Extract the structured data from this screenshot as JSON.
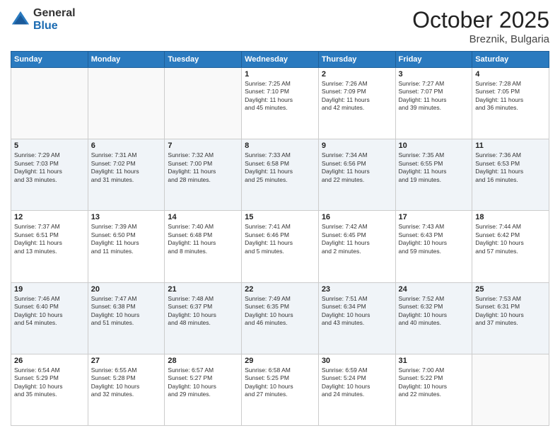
{
  "header": {
    "logo_general": "General",
    "logo_blue": "Blue",
    "month_title": "October 2025",
    "location": "Breznik, Bulgaria"
  },
  "days_of_week": [
    "Sunday",
    "Monday",
    "Tuesday",
    "Wednesday",
    "Thursday",
    "Friday",
    "Saturday"
  ],
  "weeks": [
    [
      {
        "day": "",
        "info": ""
      },
      {
        "day": "",
        "info": ""
      },
      {
        "day": "",
        "info": ""
      },
      {
        "day": "1",
        "info": "Sunrise: 7:25 AM\nSunset: 7:10 PM\nDaylight: 11 hours\nand 45 minutes."
      },
      {
        "day": "2",
        "info": "Sunrise: 7:26 AM\nSunset: 7:09 PM\nDaylight: 11 hours\nand 42 minutes."
      },
      {
        "day": "3",
        "info": "Sunrise: 7:27 AM\nSunset: 7:07 PM\nDaylight: 11 hours\nand 39 minutes."
      },
      {
        "day": "4",
        "info": "Sunrise: 7:28 AM\nSunset: 7:05 PM\nDaylight: 11 hours\nand 36 minutes."
      }
    ],
    [
      {
        "day": "5",
        "info": "Sunrise: 7:29 AM\nSunset: 7:03 PM\nDaylight: 11 hours\nand 33 minutes."
      },
      {
        "day": "6",
        "info": "Sunrise: 7:31 AM\nSunset: 7:02 PM\nDaylight: 11 hours\nand 31 minutes."
      },
      {
        "day": "7",
        "info": "Sunrise: 7:32 AM\nSunset: 7:00 PM\nDaylight: 11 hours\nand 28 minutes."
      },
      {
        "day": "8",
        "info": "Sunrise: 7:33 AM\nSunset: 6:58 PM\nDaylight: 11 hours\nand 25 minutes."
      },
      {
        "day": "9",
        "info": "Sunrise: 7:34 AM\nSunset: 6:56 PM\nDaylight: 11 hours\nand 22 minutes."
      },
      {
        "day": "10",
        "info": "Sunrise: 7:35 AM\nSunset: 6:55 PM\nDaylight: 11 hours\nand 19 minutes."
      },
      {
        "day": "11",
        "info": "Sunrise: 7:36 AM\nSunset: 6:53 PM\nDaylight: 11 hours\nand 16 minutes."
      }
    ],
    [
      {
        "day": "12",
        "info": "Sunrise: 7:37 AM\nSunset: 6:51 PM\nDaylight: 11 hours\nand 13 minutes."
      },
      {
        "day": "13",
        "info": "Sunrise: 7:39 AM\nSunset: 6:50 PM\nDaylight: 11 hours\nand 11 minutes."
      },
      {
        "day": "14",
        "info": "Sunrise: 7:40 AM\nSunset: 6:48 PM\nDaylight: 11 hours\nand 8 minutes."
      },
      {
        "day": "15",
        "info": "Sunrise: 7:41 AM\nSunset: 6:46 PM\nDaylight: 11 hours\nand 5 minutes."
      },
      {
        "day": "16",
        "info": "Sunrise: 7:42 AM\nSunset: 6:45 PM\nDaylight: 11 hours\nand 2 minutes."
      },
      {
        "day": "17",
        "info": "Sunrise: 7:43 AM\nSunset: 6:43 PM\nDaylight: 10 hours\nand 59 minutes."
      },
      {
        "day": "18",
        "info": "Sunrise: 7:44 AM\nSunset: 6:42 PM\nDaylight: 10 hours\nand 57 minutes."
      }
    ],
    [
      {
        "day": "19",
        "info": "Sunrise: 7:46 AM\nSunset: 6:40 PM\nDaylight: 10 hours\nand 54 minutes."
      },
      {
        "day": "20",
        "info": "Sunrise: 7:47 AM\nSunset: 6:38 PM\nDaylight: 10 hours\nand 51 minutes."
      },
      {
        "day": "21",
        "info": "Sunrise: 7:48 AM\nSunset: 6:37 PM\nDaylight: 10 hours\nand 48 minutes."
      },
      {
        "day": "22",
        "info": "Sunrise: 7:49 AM\nSunset: 6:35 PM\nDaylight: 10 hours\nand 46 minutes."
      },
      {
        "day": "23",
        "info": "Sunrise: 7:51 AM\nSunset: 6:34 PM\nDaylight: 10 hours\nand 43 minutes."
      },
      {
        "day": "24",
        "info": "Sunrise: 7:52 AM\nSunset: 6:32 PM\nDaylight: 10 hours\nand 40 minutes."
      },
      {
        "day": "25",
        "info": "Sunrise: 7:53 AM\nSunset: 6:31 PM\nDaylight: 10 hours\nand 37 minutes."
      }
    ],
    [
      {
        "day": "26",
        "info": "Sunrise: 6:54 AM\nSunset: 5:29 PM\nDaylight: 10 hours\nand 35 minutes."
      },
      {
        "day": "27",
        "info": "Sunrise: 6:55 AM\nSunset: 5:28 PM\nDaylight: 10 hours\nand 32 minutes."
      },
      {
        "day": "28",
        "info": "Sunrise: 6:57 AM\nSunset: 5:27 PM\nDaylight: 10 hours\nand 29 minutes."
      },
      {
        "day": "29",
        "info": "Sunrise: 6:58 AM\nSunset: 5:25 PM\nDaylight: 10 hours\nand 27 minutes."
      },
      {
        "day": "30",
        "info": "Sunrise: 6:59 AM\nSunset: 5:24 PM\nDaylight: 10 hours\nand 24 minutes."
      },
      {
        "day": "31",
        "info": "Sunrise: 7:00 AM\nSunset: 5:22 PM\nDaylight: 10 hours\nand 22 minutes."
      },
      {
        "day": "",
        "info": ""
      }
    ]
  ]
}
